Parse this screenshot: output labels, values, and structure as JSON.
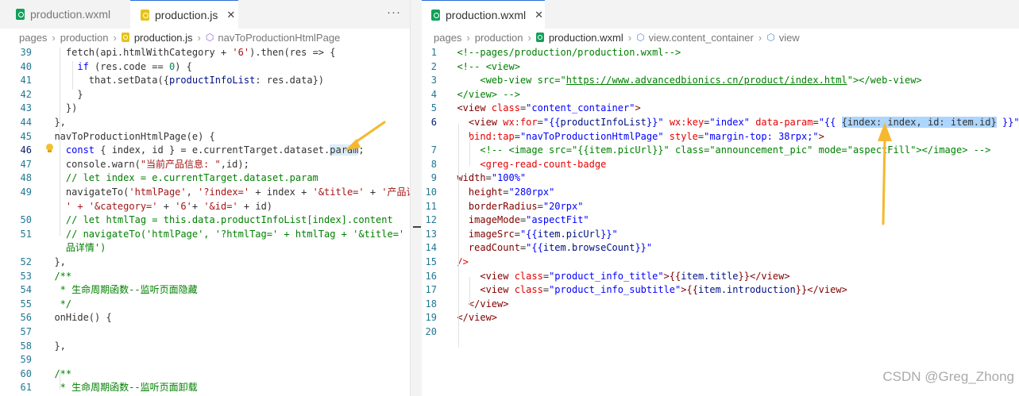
{
  "left_pane": {
    "tabs": [
      {
        "label": "production.wxml",
        "icon": "wxml-file-icon"
      },
      {
        "label": "production.js",
        "icon": "js-file-icon",
        "close": "✕"
      }
    ],
    "more": "···",
    "breadcrumb": [
      "pages",
      "production",
      "production.js",
      "navToProductionHtmlPage"
    ]
  },
  "right_pane": {
    "tabs": [
      {
        "label": "production.wxml",
        "icon": "wxml-file-icon",
        "close": "✕"
      }
    ],
    "breadcrumb": [
      "pages",
      "production",
      "production.wxml",
      "view.content_container",
      "view"
    ]
  },
  "code_left": [
    {
      "n": "39",
      "t": [
        [
          "    fetch(api.htmlWithCategory + ",
          ""
        ],
        [
          "'6'",
          "s"
        ],
        [
          ").then(res => {",
          ""
        ]
      ]
    },
    {
      "n": "40",
      "t": [
        [
          "      ",
          ""
        ],
        [
          "if",
          "k"
        ],
        [
          " (res.code == ",
          ""
        ],
        [
          "0",
          "n"
        ],
        [
          ") {",
          ""
        ]
      ]
    },
    {
      "n": "41",
      "t": [
        [
          "        that.setData({",
          ""
        ],
        [
          "productInfoList",
          "v"
        ],
        [
          ": res.data})",
          ""
        ]
      ]
    },
    {
      "n": "42",
      "t": [
        [
          "      }",
          ""
        ]
      ]
    },
    {
      "n": "43",
      "t": [
        [
          "    })",
          ""
        ]
      ]
    },
    {
      "n": "44",
      "t": [
        [
          "  },",
          ""
        ]
      ]
    },
    {
      "n": "45",
      "t": [
        [
          "  navToProductionHtmlPage(e) {",
          ""
        ]
      ]
    },
    {
      "n": "46",
      "t": [
        [
          "    ",
          ""
        ],
        [
          "const",
          "k"
        ],
        [
          " { index, id } = e.currentTarget.dataset.",
          ""
        ],
        [
          "param",
          "hlw"
        ],
        [
          ";",
          ""
        ]
      ]
    },
    {
      "n": "47",
      "t": [
        [
          "    console.warn(",
          ""
        ],
        [
          "\"当前产品信息: \"",
          "s"
        ],
        [
          ",id);",
          ""
        ]
      ]
    },
    {
      "n": "48",
      "t": [
        [
          "    // let index = e.currentTarget.dataset.param",
          "c"
        ]
      ]
    },
    {
      "n": "49",
      "t": [
        [
          "    navigateTo(",
          ""
        ],
        [
          "'htmlPage'",
          "s"
        ],
        [
          ", ",
          ""
        ],
        [
          "'?index='",
          "s"
        ],
        [
          " + index + ",
          ""
        ],
        [
          "'&title='",
          "s"
        ],
        [
          " + ",
          ""
        ],
        [
          "'产品详情",
          "s"
        ]
      ]
    },
    {
      "n": "",
      "t": [
        [
          "    ",
          ""
        ],
        [
          "' + '&category='",
          "s"
        ],
        [
          " + ",
          ""
        ],
        [
          "'6'",
          "s"
        ],
        [
          "+ ",
          ""
        ],
        [
          "'&id='",
          "s"
        ],
        [
          " + id)",
          ""
        ]
      ]
    },
    {
      "n": "50",
      "t": [
        [
          "    // let htmlTag = this.data.productInfoList[index].content",
          "c"
        ]
      ]
    },
    {
      "n": "51",
      "t": [
        [
          "    // navigateTo('htmlPage', '?htmlTag=' + htmlTag + '&title=' + '产",
          "c"
        ]
      ]
    },
    {
      "n": "",
      "t": [
        [
          "    品详情')",
          "c"
        ]
      ]
    },
    {
      "n": "52",
      "t": [
        [
          "  },",
          ""
        ]
      ]
    },
    {
      "n": "53",
      "t": [
        [
          "  /**",
          "c"
        ]
      ]
    },
    {
      "n": "54",
      "t": [
        [
          "   * 生命周期函数--监听页面隐藏",
          "c"
        ]
      ]
    },
    {
      "n": "55",
      "t": [
        [
          "   */",
          "c"
        ]
      ]
    },
    {
      "n": "56",
      "t": [
        [
          "  onHide() {",
          ""
        ]
      ]
    },
    {
      "n": "57",
      "t": [
        [
          "",
          ""
        ]
      ]
    },
    {
      "n": "58",
      "t": [
        [
          "  },",
          ""
        ]
      ]
    },
    {
      "n": "59",
      "t": [
        [
          "",
          ""
        ]
      ]
    },
    {
      "n": "60",
      "t": [
        [
          "  /**",
          "c"
        ]
      ]
    },
    {
      "n": "61",
      "t": [
        [
          "   * 生命周期函数--监听页面卸载",
          "c"
        ]
      ]
    }
  ],
  "code_right": [
    {
      "n": "1",
      "t": [
        [
          "  <!--pages/production/production.wxml-->",
          "c"
        ]
      ]
    },
    {
      "n": "2",
      "t": [
        [
          "  <!-- <view>",
          "c"
        ]
      ]
    },
    {
      "n": "3",
      "t": [
        [
          "      <web-view src=\"",
          "c"
        ],
        [
          "https://www.advancedbionics.cn/product/index.html",
          "cu"
        ],
        [
          "\"></web-view>",
          "c"
        ]
      ]
    },
    {
      "n": "4",
      "t": [
        [
          "  </view> -->",
          "c"
        ]
      ]
    },
    {
      "n": "5",
      "t": [
        [
          "  ",
          ""
        ],
        [
          "<view",
          "t"
        ],
        [
          " class",
          "a"
        ],
        [
          "=",
          ""
        ],
        [
          "\"content_container\"",
          "st"
        ],
        [
          ">",
          "t"
        ]
      ]
    },
    {
      "n": "6",
      "t": [
        [
          "    ",
          ""
        ],
        [
          "<view",
          "t"
        ],
        [
          " wx:for",
          "a"
        ],
        [
          "=",
          ""
        ],
        [
          "\"{{",
          "st"
        ],
        [
          "productInfoList",
          "v"
        ],
        [
          "}}\"",
          "st"
        ],
        [
          " wx:key",
          "a"
        ],
        [
          "=",
          ""
        ],
        [
          "\"index\"",
          "st"
        ],
        [
          " data-param",
          "a"
        ],
        [
          "=",
          ""
        ],
        [
          "\"{{ ",
          "st"
        ],
        [
          "{index: index, id: item.id}",
          "hlsel"
        ],
        [
          " }}\"",
          "st"
        ]
      ]
    },
    {
      "n": "",
      "t": [
        [
          "    ",
          ""
        ],
        [
          "bind:tap",
          "a"
        ],
        [
          "=",
          ""
        ],
        [
          "\"navToProductionHtmlPage\"",
          "st"
        ],
        [
          " style",
          "a"
        ],
        [
          "=",
          ""
        ],
        [
          "\"margin-top: 38rpx;\"",
          "st"
        ],
        [
          ">",
          "t"
        ]
      ]
    },
    {
      "n": "7",
      "t": [
        [
          "      <!-- <image src=\"{{item.picUrl}}\" class=\"announcement_pic\" mode=\"aspectFill\"></image> -->",
          "c"
        ]
      ]
    },
    {
      "n": "8",
      "t": [
        [
          "      ",
          ""
        ],
        [
          "<greg-read-count-badge",
          "a"
        ]
      ]
    },
    {
      "n": "9",
      "t": [
        [
          "  ",
          ""
        ],
        [
          "width",
          "p"
        ],
        [
          "=",
          ""
        ],
        [
          "\"100%\"",
          "st"
        ]
      ]
    },
    {
      "n": "10",
      "t": [
        [
          "    ",
          ""
        ],
        [
          "height",
          "p"
        ],
        [
          "=",
          ""
        ],
        [
          "\"280rpx\"",
          "st"
        ]
      ]
    },
    {
      "n": "11",
      "t": [
        [
          "    ",
          ""
        ],
        [
          "borderRadius",
          "p"
        ],
        [
          "=",
          ""
        ],
        [
          "\"20rpx\"",
          "st"
        ]
      ]
    },
    {
      "n": "12",
      "t": [
        [
          "    ",
          ""
        ],
        [
          "imageMode",
          "p"
        ],
        [
          "=",
          ""
        ],
        [
          "\"aspectFit\"",
          "st"
        ]
      ]
    },
    {
      "n": "13",
      "t": [
        [
          "    ",
          ""
        ],
        [
          "imageSrc",
          "p"
        ],
        [
          "=",
          ""
        ],
        [
          "\"{{",
          "st"
        ],
        [
          "item.picUrl",
          "v"
        ],
        [
          "}}\"",
          "st"
        ]
      ]
    },
    {
      "n": "14",
      "t": [
        [
          "    ",
          ""
        ],
        [
          "readCount",
          "p"
        ],
        [
          "=",
          ""
        ],
        [
          "\"{{",
          "st"
        ],
        [
          "item.browseCount",
          "v"
        ],
        [
          "}}\"",
          "st"
        ]
      ]
    },
    {
      "n": "15",
      "t": [
        [
          "  ",
          ""
        ],
        [
          "/>",
          "a"
        ]
      ]
    },
    {
      "n": "16",
      "t": [
        [
          "      ",
          ""
        ],
        [
          "<view",
          "t"
        ],
        [
          " class",
          "a"
        ],
        [
          "=",
          ""
        ],
        [
          "\"product_info_title\"",
          "st"
        ],
        [
          ">{{",
          "t"
        ],
        [
          "item.title",
          "v"
        ],
        [
          "}}</view>",
          "t"
        ]
      ]
    },
    {
      "n": "17",
      "t": [
        [
          "      ",
          ""
        ],
        [
          "<view",
          "t"
        ],
        [
          " class",
          "a"
        ],
        [
          "=",
          ""
        ],
        [
          "\"product_info_subtitle\"",
          "st"
        ],
        [
          ">{{",
          "t"
        ],
        [
          "item.introduction",
          "v"
        ],
        [
          "}}</view>",
          "t"
        ]
      ]
    },
    {
      "n": "18",
      "t": [
        [
          "    ",
          ""
        ],
        [
          "</view>",
          "t"
        ]
      ]
    },
    {
      "n": "19",
      "t": [
        [
          "  ",
          ""
        ],
        [
          "</view>",
          "t"
        ]
      ]
    },
    {
      "n": "20",
      "t": [
        [
          "",
          ""
        ]
      ]
    }
  ],
  "watermark": "CSDN @Greg_Zhong"
}
